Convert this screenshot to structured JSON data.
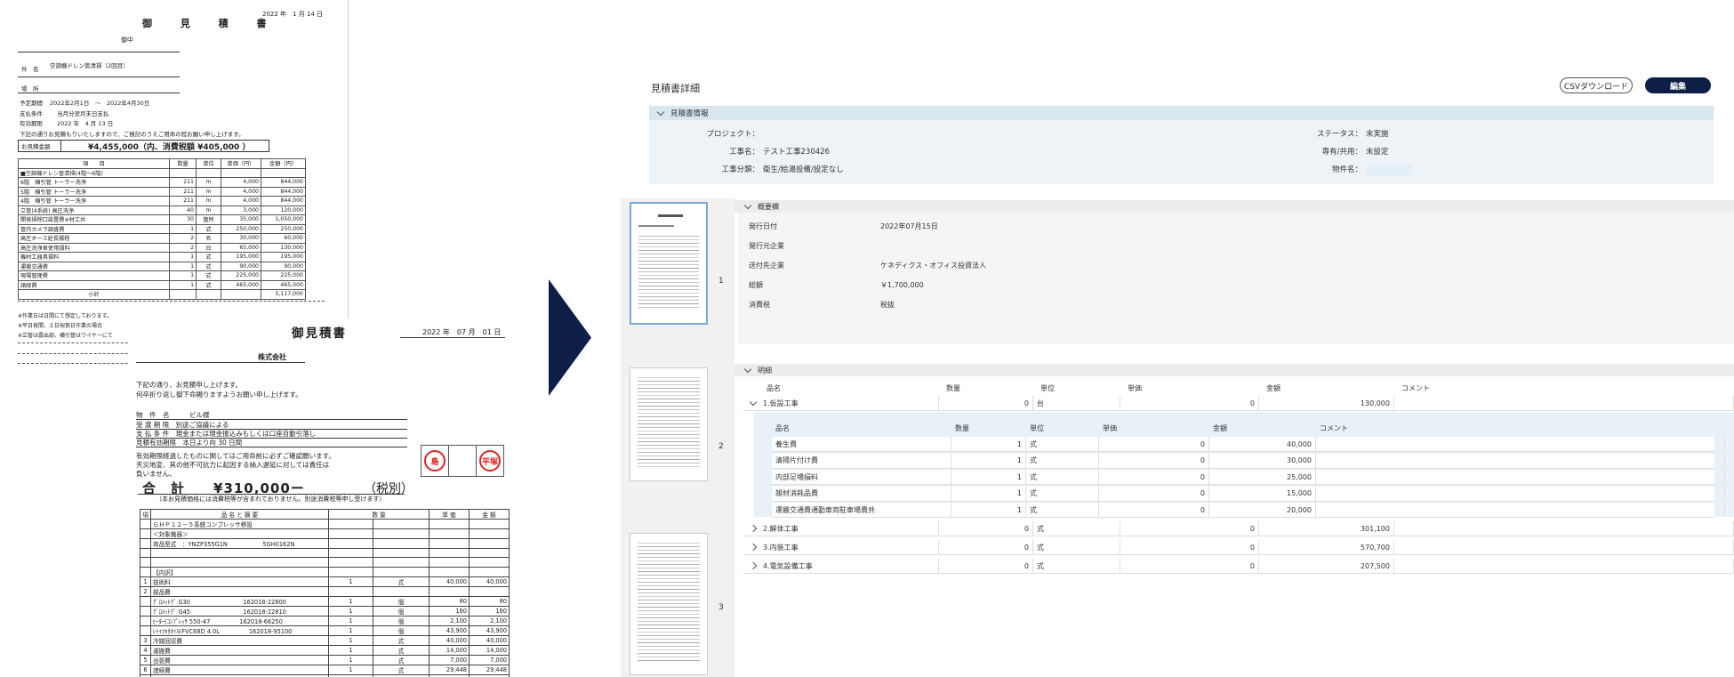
{
  "doc1": {
    "date": "2022 年　1 月 14 日",
    "title": "御 見 積 書",
    "recipient": "御中",
    "subject_label": "件　名",
    "subject": "空調機ドレン管清掃（2回目）",
    "place_label": "場　所",
    "period_label": "予定期間",
    "period": "2022年2月1日　～　2022年4月30日",
    "payment_label": "支払条件",
    "payment": "当月分翌月末日支払",
    "valid_label": "有効期限",
    "valid": "2022 年　4 月 13 日",
    "intro": "下記の通りお見積もりいたしますので、ご検討のうえご用命の程お願い申し上げます。",
    "total_label": "お見積金額",
    "total": "¥4,455,000（内、消費税額 ¥405,000 ）",
    "headers": [
      "項　　目",
      "数量",
      "単位",
      "単価（円）",
      "金額（円）"
    ],
    "rows": [
      [
        "■空調機ドレン管清掃(4階〜6階)",
        "",
        "",
        "",
        ""
      ],
      [
        "6階　横引管 トーラー洗浄",
        "211",
        "m",
        "4,000",
        "844,000"
      ],
      [
        "5階　横引管 トーラー洗浄",
        "211",
        "m",
        "4,000",
        "844,000"
      ],
      [
        "4階　横引管 トーラー洗浄",
        "211",
        "m",
        "4,000",
        "844,000"
      ],
      [
        "立管(4系統) 高圧洗浄",
        "40",
        "m",
        "3,000",
        "120,000"
      ],
      [
        "開発掃除口設置費※材工共",
        "30",
        "箇所",
        "35,000",
        "1,050,000"
      ],
      [
        "管内カメラ調査費",
        "1",
        "式",
        "250,000",
        "250,000"
      ],
      [
        "高圧ホース延長揚程",
        "2",
        "名",
        "30,000",
        "60,000"
      ],
      [
        "高圧洗浄車使用損料",
        "2",
        "日",
        "65,000",
        "130,000"
      ],
      [
        "機材工器具損料",
        "1",
        "式",
        "195,000",
        "195,000"
      ],
      [
        "運搬交通費",
        "1",
        "式",
        "90,000",
        "90,000"
      ],
      [
        "現場管理費",
        "1",
        "式",
        "225,000",
        "225,000"
      ],
      [
        "諸経費",
        "1",
        "式",
        "465,000",
        "465,000"
      ],
      [
        "小計",
        "",
        "",
        "",
        "5,117,000"
      ]
    ],
    "notes": [
      "※作業日は日間にて想定しております。",
      "※平日夜間、土日祝祭日作業の場合",
      "※立管は露出部、横引管はワイヤーにて"
    ]
  },
  "doc2": {
    "title": "御見積書",
    "date": "2022 年　07 月　01 日",
    "company": "株式会社",
    "greeting1": "下記の通り、お見積申し上げます。",
    "greeting2": "何卒折り返し御下命賜りますようお願い申し上げます。",
    "fields": [
      "物　件　名　　　ビル様",
      "受 渡 期 限　別途ご協議による",
      "支 払 条 件　現金または現金振込みもしくは口座自動引落し",
      "見積有効期限　本日より向 30 日間"
    ],
    "disclaimer1": "有効期限経過したものに関してはご用命前に必ずご確認願います。",
    "disclaimer2": "天災地変、其の他不可抗力に起因する納入遅延に対しては責任は",
    "disclaimer3": "負いません。",
    "stamp1": "島",
    "stamp2": "平塚",
    "grand_label": "合　計　　¥310,000ー",
    "grand_tax": "（税別）",
    "grand_note": "（本お見積価格には消費税等が含まれておりません。別途消費税等申し受けます）",
    "headers": [
      "項",
      "品 名 と 摘 要",
      "数 量",
      "単 価",
      "金 額"
    ],
    "rows": [
      [
        "",
        "ＧＨＰ１２－５系統コンプレッサ移設",
        "",
        "",
        "",
        ""
      ],
      [
        "",
        "＜対象機器＞",
        "",
        "",
        "",
        ""
      ],
      [
        "",
        "商品型式　：YNZP355G1N　　　　　　5GH0162N",
        "",
        "",
        "",
        ""
      ],
      [
        "",
        "",
        "",
        "",
        "",
        ""
      ],
      [
        "",
        "",
        "",
        "",
        "",
        ""
      ],
      [
        "",
        "【内訳】",
        "",
        "",
        "",
        ""
      ],
      [
        "1",
        "技術料",
        "1",
        "式",
        "40,000",
        "40,000"
      ],
      [
        "2",
        "部品費",
        "",
        "",
        "",
        ""
      ],
      [
        "",
        "ｸﾞﾛﾒｯﾄｸﾞ G30　　　　　　　　　162018-22800",
        "1",
        "個",
        "80",
        "80"
      ],
      [
        "",
        "ｸﾞﾛﾒｯﾄｸﾞ G45　　　　　　　　　162018-22810",
        "1",
        "個",
        "160",
        "160"
      ],
      [
        "",
        "ﾋｰﾀｰ(ｺﾝﾌﾟﾚｯｻ 550-47　　　　　162018-66250",
        "1",
        "個",
        "2,100",
        "2,100"
      ],
      [
        "",
        "ﾚｲｲﾂｷﾀｵｲﾙ(FVC68D 4.0L　　　　　162018-95100",
        "1",
        "個",
        "43,900",
        "43,900"
      ],
      [
        "3",
        "冷媒回収費",
        "1",
        "式",
        "40,000",
        "40,000"
      ],
      [
        "4",
        "運搬費",
        "1",
        "式",
        "14,000",
        "14,000"
      ],
      [
        "5",
        "出張費",
        "1",
        "式",
        "7,000",
        "7,000"
      ],
      [
        "6",
        "諸経費",
        "1",
        "式",
        "29,448",
        "29,448"
      ],
      [
        "7",
        "値引き",
        "1",
        "式",
        "-6,688",
        "-6,688"
      ]
    ]
  },
  "app": {
    "page_title": "見積書詳細",
    "csv_button": "CSVダウンロード",
    "edit_button": "編集",
    "info_section": "見積書情報",
    "info": {
      "project_label": "プロジェクト：",
      "project_value": "",
      "construction_label": "工事名：",
      "construction_value": "テスト工事230426",
      "category_label": "工事分類：",
      "category_value": "衛生/給湯設備/設定なし",
      "status_label": "ステータス：",
      "status_value": "未実施",
      "exclusive_label": "専有/共用：",
      "exclusive_value": "未設定",
      "building_label": "物件名：",
      "building_value": ""
    },
    "thumb_numbers": [
      "1",
      "2",
      "3"
    ],
    "overview_section": "概要欄",
    "overview": [
      {
        "label": "発行日付",
        "value": "2022年07月15日"
      },
      {
        "label": "発行元企業",
        "value": ""
      },
      {
        "label": "送付先企業",
        "value": "ケネディクス・オフィス投資法人"
      },
      {
        "label": "総額",
        "value": "￥1,700,000"
      },
      {
        "label": "消費税",
        "value": "税抜"
      }
    ],
    "detail_section": "明細",
    "columns": [
      "品名",
      "数量",
      "単位",
      "単価",
      "金額",
      "コメント"
    ],
    "items": [
      {
        "name": "1.仮設工事",
        "qty": "0",
        "unit": "台",
        "price": "0",
        "amount": "130,000",
        "comment": "",
        "expanded": true
      },
      {
        "name": "2.解体工事",
        "qty": "0",
        "unit": "式",
        "price": "0",
        "amount": "301,100",
        "comment": "",
        "expanded": false
      },
      {
        "name": "3.内装工事",
        "qty": "0",
        "unit": "式",
        "price": "0",
        "amount": "570,700",
        "comment": "",
        "expanded": false
      },
      {
        "name": "4.電気設備工事",
        "qty": "0",
        "unit": "式",
        "price": "0",
        "amount": "207,500",
        "comment": "",
        "expanded": false
      }
    ],
    "sub_items": [
      {
        "name": "養生費",
        "qty": "1",
        "unit": "式",
        "price": "0",
        "amount": "40,000",
        "comment": ""
      },
      {
        "name": "清掃片付け費",
        "qty": "1",
        "unit": "式",
        "price": "0",
        "amount": "30,000",
        "comment": ""
      },
      {
        "name": "内部足場損料",
        "qty": "1",
        "unit": "式",
        "price": "0",
        "amount": "25,000",
        "comment": ""
      },
      {
        "name": "雑材消耗品費",
        "qty": "1",
        "unit": "式",
        "price": "0",
        "amount": "15,000",
        "comment": ""
      },
      {
        "name": "運搬交通費通勤車両駐車場費共",
        "qty": "1",
        "unit": "式",
        "price": "0",
        "amount": "20,000",
        "comment": ""
      }
    ],
    "colors": {
      "navy": "#0d1f47",
      "info_head": "#d8e6f0",
      "info_body": "#eef3f7"
    }
  }
}
